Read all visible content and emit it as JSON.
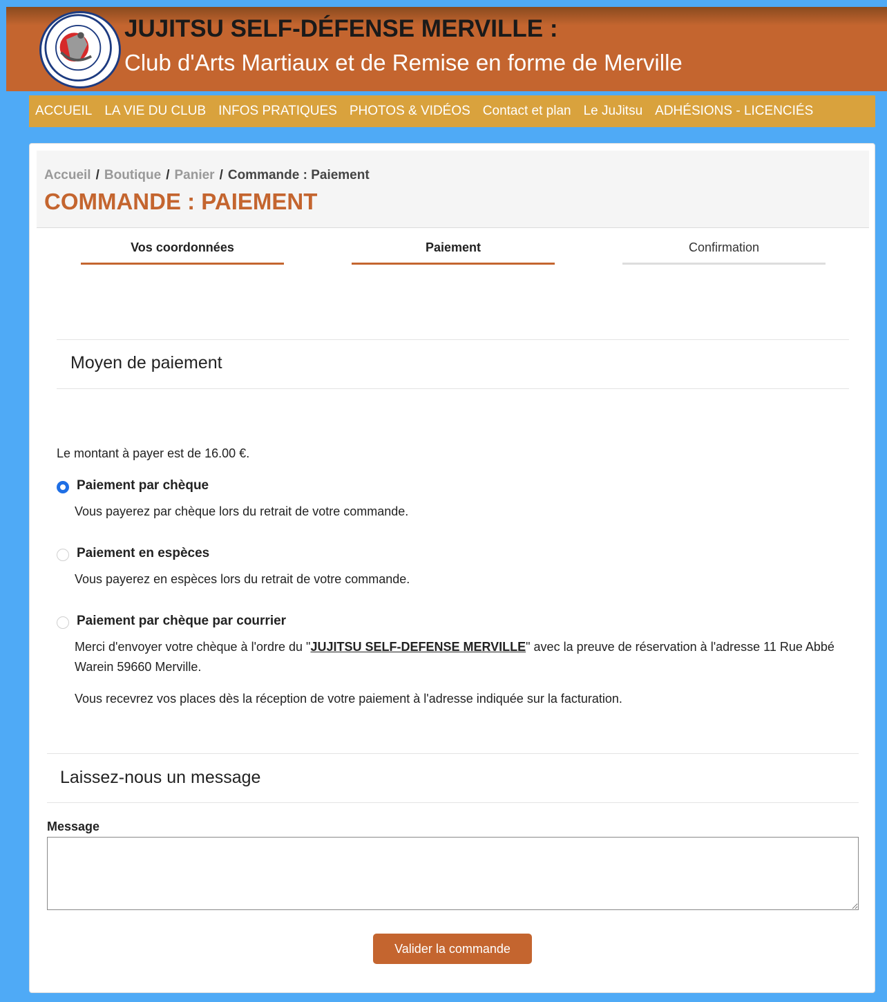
{
  "header": {
    "title": "JUJITSU SELF-DÉFENSE MERVILLE :",
    "subtitle": "Club d'Arts Martiaux et de Remise en forme de Merville",
    "logo_text_top": "JUJITSU SELF-DEFENSE",
    "logo_text_bottom": "MERVILLE"
  },
  "nav": {
    "items": [
      "ACCUEIL",
      "LA VIE DU CLUB",
      "INFOS PRATIQUES",
      "PHOTOS & VIDÉOS",
      "Contact et plan",
      "Le JuJitsu",
      "ADHÉSIONS - LICENCIÉS"
    ]
  },
  "breadcrumb": {
    "items": [
      "Accueil",
      "Boutique",
      "Panier"
    ],
    "current": "Commande : Paiement",
    "separator": "/"
  },
  "page_title": "COMMANDE : PAIEMENT",
  "steps": [
    "Vos coordonnées",
    "Paiement",
    "Confirmation"
  ],
  "payment": {
    "section_title": "Moyen de paiement",
    "amount_text": "Le montant à payer est de 16.00 €.",
    "options": [
      {
        "label": "Paiement par chèque",
        "description": "Vous payerez par chèque lors du retrait de votre commande.",
        "checked": true
      },
      {
        "label": "Paiement en espèces",
        "description": "Vous payerez en espèces lors du retrait de votre commande.",
        "checked": false
      },
      {
        "label": "Paiement par chèque par courrier",
        "description_before": "Merci d'envoyer votre chèque à l'ordre du \"",
        "description_link": "JUJITSU SELF-DEFENSE MERVILLE",
        "description_after": "\" avec la preuve de réservation à l'adresse 11 Rue Abbé Warein 59660 Merville.",
        "description_2": "Vous recevrez vos places dès la réception de votre paiement à l'adresse indiquée sur la facturation.",
        "checked": false
      }
    ]
  },
  "message": {
    "section_title": "Laissez-nous un message",
    "label": "Message",
    "value": ""
  },
  "submit_label": "Valider la commande",
  "colors": {
    "page_bg": "#4faaf6",
    "header": "#c4652f",
    "nav": "#d9a23d",
    "accent": "#c4652f",
    "radio": "#1f6fe5"
  }
}
